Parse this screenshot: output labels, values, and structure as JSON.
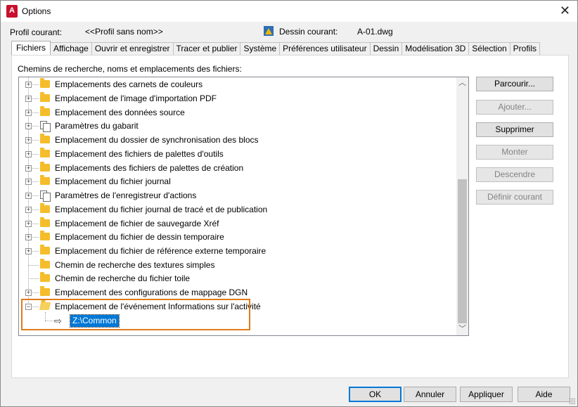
{
  "window": {
    "title": "Options",
    "app_icon": "A"
  },
  "header": {
    "profile_label": "Profil courant:",
    "profile_value": "<<Profil sans nom>>",
    "drawing_label": "Dessin courant:",
    "drawing_value": "A-01.dwg"
  },
  "tabs": [
    {
      "label": "Fichiers",
      "active": true
    },
    {
      "label": "Affichage"
    },
    {
      "label": "Ouvrir et enregistrer"
    },
    {
      "label": "Tracer et publier"
    },
    {
      "label": "Système"
    },
    {
      "label": "Préférences utilisateur"
    },
    {
      "label": "Dessin"
    },
    {
      "label": "Modélisation 3D"
    },
    {
      "label": "Sélection"
    },
    {
      "label": "Profils"
    }
  ],
  "panel": {
    "label": "Chemins de recherche, noms et emplacements des fichiers:"
  },
  "tree": {
    "items": [
      {
        "label": "Emplacements des carnets de couleurs",
        "icon": "folder-icon"
      },
      {
        "label": "Emplacement de l'image d'importation PDF",
        "icon": "folder-icon"
      },
      {
        "label": "Emplacement des données source",
        "icon": "folder-icon"
      },
      {
        "label": "Paramètres du gabarit",
        "icon": "documents-icon"
      },
      {
        "label": "Emplacement du dossier de synchronisation des blocs",
        "icon": "folder-icon"
      },
      {
        "label": "Emplacement des fichiers de palettes d'outils",
        "icon": "folder-icon"
      },
      {
        "label": "Emplacements des fichiers de palettes de création",
        "icon": "folder-icon"
      },
      {
        "label": "Emplacement du fichier journal",
        "icon": "folder-icon"
      },
      {
        "label": "Paramètres de l'enregistreur d'actions",
        "icon": "documents-icon"
      },
      {
        "label": "Emplacement du fichier journal de tracé et de publication",
        "icon": "folder-icon"
      },
      {
        "label": "Emplacement de fichier de sauvegarde Xréf",
        "icon": "folder-icon"
      },
      {
        "label": "Emplacement du fichier de dessin temporaire",
        "icon": "folder-icon"
      },
      {
        "label": "Emplacement du fichier de référence externe temporaire",
        "icon": "folder-icon"
      },
      {
        "label": "Chemin de recherche des textures simples",
        "icon": "folder-icon"
      },
      {
        "label": "Chemin de recherche du fichier toile",
        "icon": "folder-icon"
      },
      {
        "label": "Emplacement des configurations de mappage DGN",
        "icon": "folder-icon"
      },
      {
        "label": "Emplacement de l'événement Informations sur l'activité",
        "icon": "open-folder-icon",
        "expanded": true
      }
    ],
    "expanded_child": "Z:\\Common"
  },
  "side_buttons": {
    "browse": "Parcourir...",
    "add": "Ajouter...",
    "remove": "Supprimer",
    "move_up": "Monter",
    "move_down": "Descendre",
    "set_current": "Définir courant"
  },
  "bottom_buttons": {
    "ok": "OK",
    "cancel": "Annuler",
    "apply": "Appliquer",
    "help": "Aide"
  },
  "colors": {
    "highlight_box": "#e07b1a",
    "selection": "#0078d7",
    "folder": "#f5bd2b"
  }
}
